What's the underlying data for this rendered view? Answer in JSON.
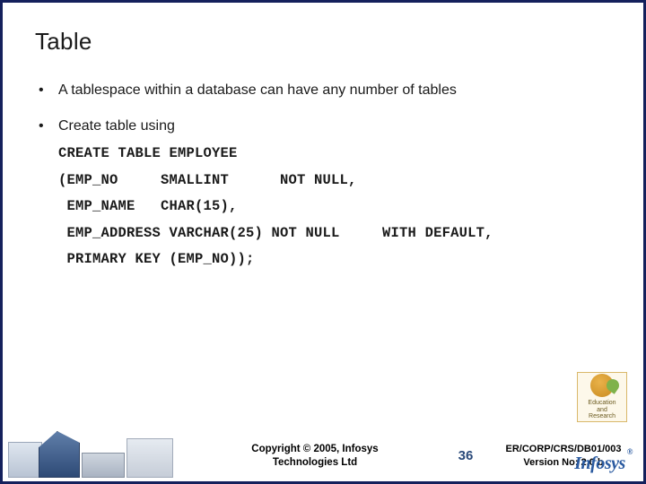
{
  "title": "Table",
  "bullets": [
    {
      "text": "A tablespace within a database can have any number of tables"
    },
    {
      "text": "Create table using"
    }
  ],
  "code": {
    "line1": "CREATE TABLE EMPLOYEE",
    "line2": "(EMP_NO     SMALLINT      NOT NULL,",
    "line3": " EMP_NAME   CHAR(15),",
    "line4": " EMP_ADDRESS VARCHAR(25) NOT NULL     WITH DEFAULT,",
    "line5": " PRIMARY KEY (EMP_NO));"
  },
  "footer": {
    "copyright_line1": "Copyright © 2005, Infosys",
    "copyright_line2": "Technologies Ltd",
    "page_number": "36",
    "doc_ref_line1": "ER/CORP/CRS/DB01/003",
    "doc_ref_line2": "Version No: 2.0 b"
  },
  "badge": {
    "line1": "Education",
    "line2": "and",
    "line3": "Research"
  },
  "logo": {
    "text": "Infosys",
    "reg": "®"
  }
}
